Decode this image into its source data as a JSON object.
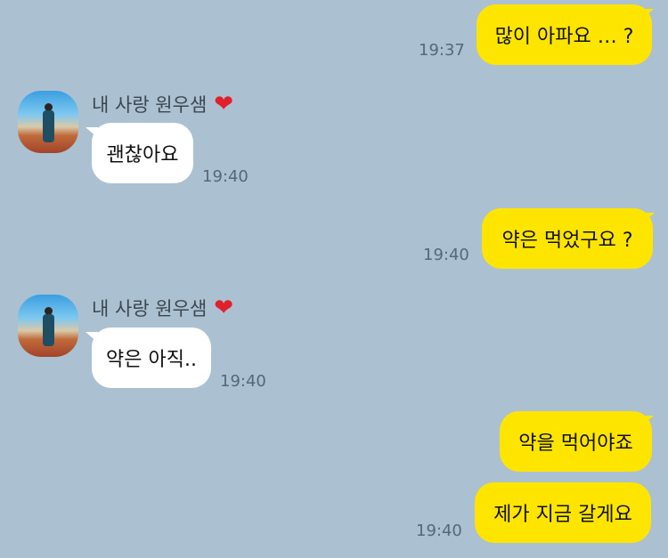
{
  "sender": {
    "name": "내 사랑 원우샘",
    "heart": "❤"
  },
  "messages": [
    {
      "from": "me",
      "text": "많이 아파요 … ?",
      "time": "19:37"
    },
    {
      "from": "them",
      "text": "괜찮아요",
      "time": "19:40"
    },
    {
      "from": "me",
      "text": "약은 먹었구요 ?",
      "time": "19:40"
    },
    {
      "from": "them",
      "text": "약은 아직..",
      "time": "19:40"
    },
    {
      "from": "me",
      "text": "약을 먹어야죠",
      "time": ""
    },
    {
      "from": "me",
      "text": "제가 지금 갈게요",
      "time": "19:40"
    }
  ],
  "colors": {
    "background": "#abc1d1",
    "my_bubble": "#fee500",
    "their_bubble": "#ffffff"
  }
}
